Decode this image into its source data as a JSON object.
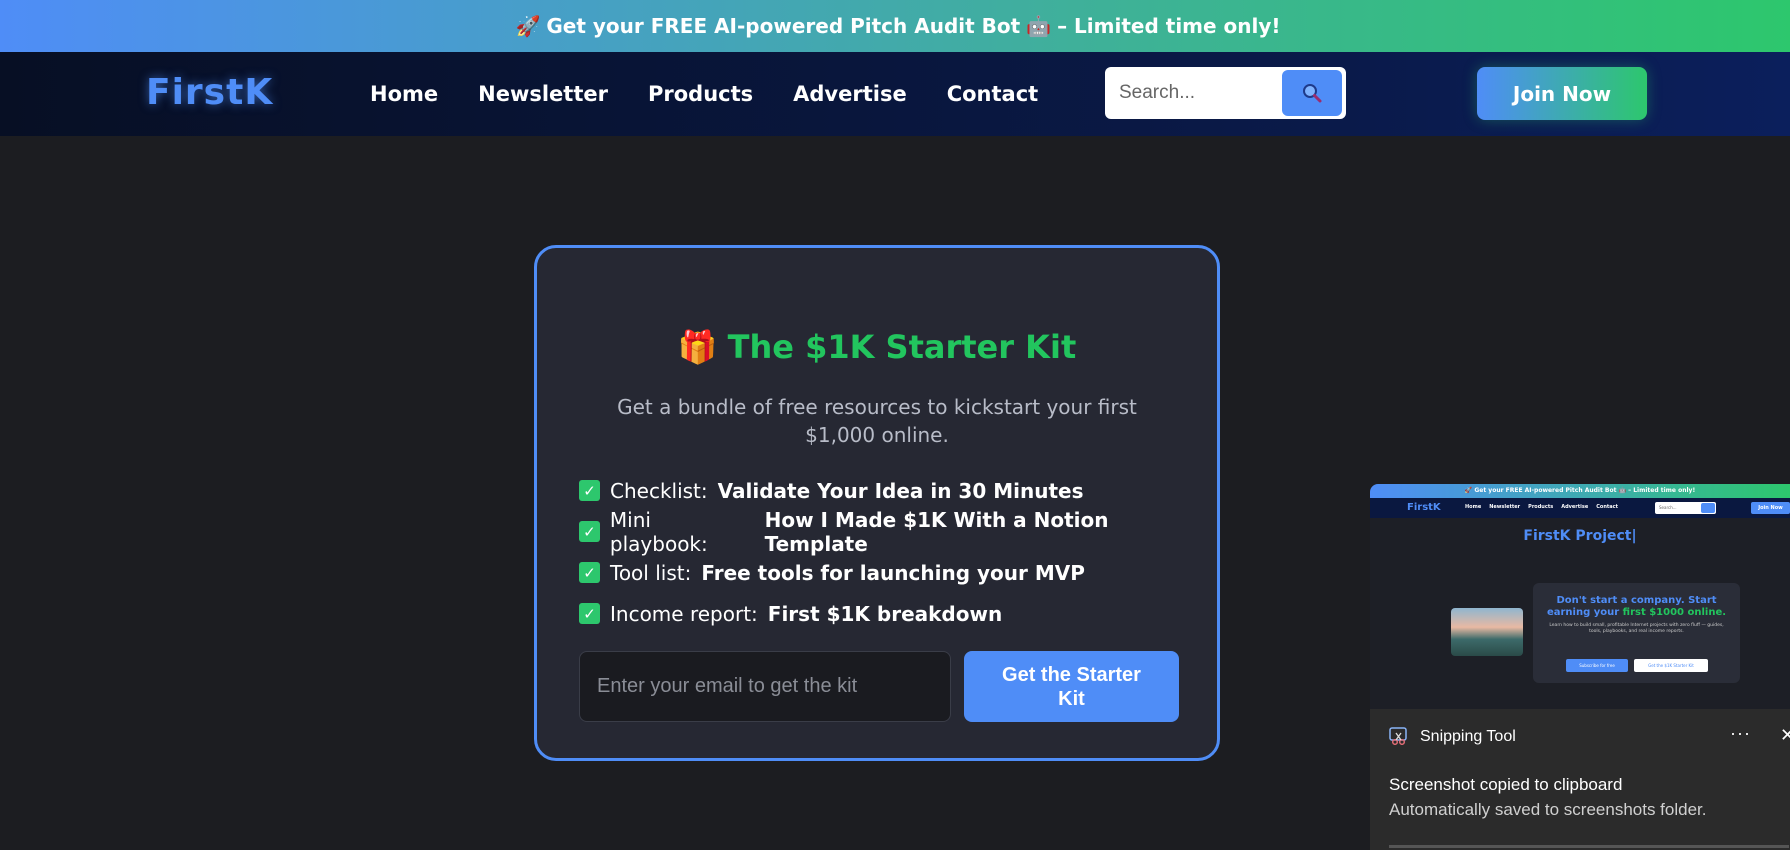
{
  "promo": {
    "rocket": "🚀",
    "text": "Get your FREE AI-powered Pitch Audit Bot",
    "robot": "🤖",
    "suffix": "– Limited time only!"
  },
  "nav": {
    "logo": "FirstK",
    "links": [
      "Home",
      "Newsletter",
      "Products",
      "Advertise",
      "Contact"
    ],
    "search_placeholder": "Search...",
    "search_icon": "magnifier-icon",
    "join_label": "Join Now"
  },
  "kit": {
    "gift": "🎁",
    "title": "The $1K Starter Kit",
    "description": "Get a bundle of free resources to kickstart your first $1,000 online.",
    "items": [
      {
        "label": "Checklist:",
        "value": "Validate Your Idea in 30 Minutes"
      },
      {
        "label": "Mini playbook:",
        "value": "How I Made $1K With a Notion Template"
      },
      {
        "label": "Tool list:",
        "value": "Free tools for launching your MVP"
      },
      {
        "label": "Income report:",
        "value": "First $1K breakdown"
      }
    ],
    "email_placeholder": "Enter your email to get the kit",
    "button_label": "Get the Starter Kit"
  },
  "snip": {
    "preview": {
      "promo": "🚀 Get your FREE AI-powered Pitch Audit Bot 🤖 – Limited time only!",
      "logo": "FirstK",
      "links": [
        "Home",
        "Newsletter",
        "Products",
        "Advertise",
        "Contact"
      ],
      "search": "Search...",
      "join": "Join Now",
      "title": "FirstK Project|",
      "headline_a": "Don't start a company. Start earning your",
      "headline_b": "first $1000 online.",
      "body": "Learn how to build small, profitable Internet projects with zero fluff — guides, tools, playbooks, and real income reports.",
      "btn_primary": "Subscribe for free",
      "btn_secondary": "Get the $1K Starter Kit"
    },
    "app_name": "Snipping Tool",
    "more": "···",
    "close": "✕",
    "line1": "Screenshot copied to clipboard",
    "line2": "Automatically saved to screenshots folder."
  }
}
